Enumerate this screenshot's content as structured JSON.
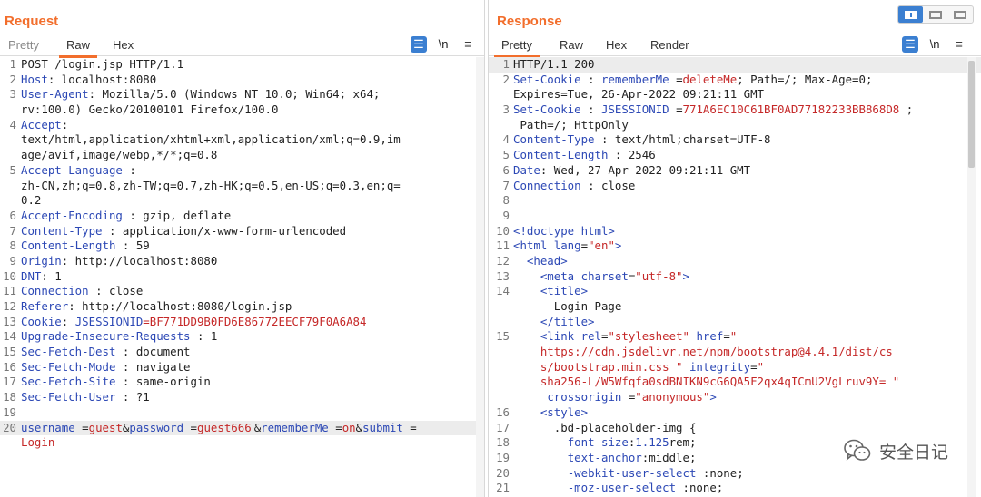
{
  "request": {
    "title": "Request",
    "tabs": [
      "Pretty",
      "Raw",
      "Hex"
    ],
    "active_tab": "Raw",
    "lines": [
      {
        "n": "1",
        "segs": [
          [
            "",
            "POST /login.jsp HTTP/1.1"
          ]
        ]
      },
      {
        "n": "2",
        "segs": [
          [
            "k",
            "Host"
          ],
          [
            "",
            ": localhost:8080"
          ]
        ]
      },
      {
        "n": "3",
        "segs": [
          [
            "k",
            "User-Agent"
          ],
          [
            "",
            ": Mozilla/5.0 (Windows NT 10.0; Win64; x64;"
          ]
        ]
      },
      {
        "n": "",
        "segs": [
          [
            "",
            "rv:100.0) Gecko/20100101 Firefox/100.0"
          ]
        ]
      },
      {
        "n": "4",
        "segs": [
          [
            "k",
            "Accept"
          ],
          [
            "",
            ":"
          ]
        ]
      },
      {
        "n": "",
        "segs": [
          [
            "",
            "text/html,application/xhtml+xml,application/xml;q=0.9,im"
          ]
        ]
      },
      {
        "n": "",
        "segs": [
          [
            "",
            "age/avif,image/webp,*/*;q=0.8"
          ]
        ]
      },
      {
        "n": "5",
        "segs": [
          [
            "k",
            "Accept-Language"
          ],
          [
            "",
            " :"
          ]
        ]
      },
      {
        "n": "",
        "segs": [
          [
            "",
            "zh-CN,zh;q=0.8,zh-TW;q=0.7,zh-HK;q=0.5,en-US;q=0.3,en;q="
          ]
        ]
      },
      {
        "n": "",
        "segs": [
          [
            "",
            "0.2"
          ]
        ]
      },
      {
        "n": "6",
        "segs": [
          [
            "k",
            "Accept-Encoding"
          ],
          [
            "",
            " : gzip, deflate"
          ]
        ]
      },
      {
        "n": "7",
        "segs": [
          [
            "k",
            "Content-Type"
          ],
          [
            "",
            " : application/x-www-form-urlencoded"
          ]
        ]
      },
      {
        "n": "8",
        "segs": [
          [
            "k",
            "Content-Length"
          ],
          [
            "",
            " : 59"
          ]
        ]
      },
      {
        "n": "9",
        "segs": [
          [
            "k",
            "Origin"
          ],
          [
            "",
            ": http://localhost:8080"
          ]
        ]
      },
      {
        "n": "10",
        "segs": [
          [
            "k",
            "DNT"
          ],
          [
            "",
            ": 1"
          ]
        ]
      },
      {
        "n": "11",
        "segs": [
          [
            "k",
            "Connection"
          ],
          [
            "",
            " : close"
          ]
        ]
      },
      {
        "n": "12",
        "segs": [
          [
            "k",
            "Referer"
          ],
          [
            "",
            ": http://localhost:8080/login.jsp"
          ]
        ]
      },
      {
        "n": "13",
        "segs": [
          [
            "k",
            "Cookie"
          ],
          [
            "",
            ": "
          ],
          [
            "k",
            "JSESSIONID"
          ],
          [
            "v",
            "=BF771DD9B0FD6E86772EECF79F0A6A84"
          ]
        ]
      },
      {
        "n": "14",
        "segs": [
          [
            "k",
            "Upgrade-Insecure-Requests"
          ],
          [
            "",
            " : 1"
          ]
        ]
      },
      {
        "n": "15",
        "segs": [
          [
            "k",
            "Sec-Fetch-Dest"
          ],
          [
            "",
            " : document"
          ]
        ]
      },
      {
        "n": "16",
        "segs": [
          [
            "k",
            "Sec-Fetch-Mode"
          ],
          [
            "",
            " : navigate"
          ]
        ]
      },
      {
        "n": "17",
        "segs": [
          [
            "k",
            "Sec-Fetch-Site"
          ],
          [
            "",
            " : same-origin"
          ]
        ]
      },
      {
        "n": "18",
        "segs": [
          [
            "k",
            "Sec-Fetch-User"
          ],
          [
            "",
            " : ?1"
          ]
        ]
      },
      {
        "n": "19",
        "segs": []
      },
      {
        "n": "20",
        "hl": true,
        "segs": [
          [
            "k",
            "username"
          ],
          [
            "",
            " ="
          ],
          [
            "v",
            "guest"
          ],
          [
            "",
            "&"
          ],
          [
            "k",
            "password"
          ],
          [
            "",
            " ="
          ],
          [
            "v",
            "guest666"
          ],
          [
            "caret",
            ""
          ],
          [
            "",
            "&"
          ],
          [
            "k",
            "rememberMe"
          ],
          [
            "",
            " ="
          ],
          [
            "v",
            "on"
          ],
          [
            "",
            "&"
          ],
          [
            "k",
            "submit"
          ],
          [
            "",
            " ="
          ]
        ]
      },
      {
        "n": "",
        "segs": [
          [
            "v",
            "Login"
          ]
        ]
      }
    ]
  },
  "response": {
    "title": "Response",
    "tabs": [
      "Pretty",
      "Raw",
      "Hex",
      "Render"
    ],
    "active_tab": "Pretty",
    "lines": [
      {
        "n": "1",
        "hl": true,
        "segs": [
          [
            "",
            "HTTP/1.1 200"
          ]
        ]
      },
      {
        "n": "2",
        "segs": [
          [
            "k",
            "Set-Cookie"
          ],
          [
            "",
            " : "
          ],
          [
            "k",
            "rememberMe"
          ],
          [
            "",
            " ="
          ],
          [
            "v",
            "deleteMe"
          ],
          [
            "",
            "; Path=/; Max-Age=0;"
          ]
        ]
      },
      {
        "n": "",
        "segs": [
          [
            "",
            "Expires=Tue, 26-Apr-2022 09:21:11 GMT"
          ]
        ]
      },
      {
        "n": "3",
        "segs": [
          [
            "k",
            "Set-Cookie"
          ],
          [
            "",
            " : "
          ],
          [
            "k",
            "JSESSIONID"
          ],
          [
            "",
            " ="
          ],
          [
            "v",
            "771A6EC10C61BF0AD77182233BB868D8"
          ],
          [
            "",
            " ;"
          ]
        ]
      },
      {
        "n": "",
        "segs": [
          [
            "",
            " Path=/; HttpOnly"
          ]
        ]
      },
      {
        "n": "4",
        "segs": [
          [
            "k",
            "Content-Type"
          ],
          [
            "",
            " : text/html;charset=UTF-8"
          ]
        ]
      },
      {
        "n": "5",
        "segs": [
          [
            "k",
            "Content-Length"
          ],
          [
            "",
            " : 2546"
          ]
        ]
      },
      {
        "n": "6",
        "segs": [
          [
            "k",
            "Date"
          ],
          [
            "",
            ": Wed, 27 Apr 2022 09:21:11 GMT"
          ]
        ]
      },
      {
        "n": "7",
        "segs": [
          [
            "k",
            "Connection"
          ],
          [
            "",
            " : close"
          ]
        ]
      },
      {
        "n": "8",
        "segs": []
      },
      {
        "n": "9",
        "segs": []
      },
      {
        "n": "10",
        "segs": [
          [
            "t",
            "<!doctype html>"
          ]
        ]
      },
      {
        "n": "11",
        "segs": [
          [
            "t",
            "<html "
          ],
          [
            "k",
            "lang"
          ],
          [
            "",
            "="
          ],
          [
            "s",
            "\"en\""
          ],
          [
            "t",
            ">"
          ]
        ]
      },
      {
        "n": "12",
        "segs": [
          [
            "",
            "  "
          ],
          [
            "t",
            "<head>"
          ]
        ]
      },
      {
        "n": "13",
        "segs": [
          [
            "",
            "    "
          ],
          [
            "t",
            "<meta "
          ],
          [
            "k",
            "charset"
          ],
          [
            "",
            "="
          ],
          [
            "s",
            "\"utf-8\""
          ],
          [
            "t",
            ">"
          ]
        ]
      },
      {
        "n": "14",
        "segs": [
          [
            "",
            "    "
          ],
          [
            "t",
            "<title>"
          ]
        ]
      },
      {
        "n": "",
        "segs": [
          [
            "",
            "      Login Page"
          ]
        ]
      },
      {
        "n": "",
        "segs": [
          [
            "",
            "    "
          ],
          [
            "t",
            "</title>"
          ]
        ]
      },
      {
        "n": "15",
        "segs": [
          [
            "",
            "    "
          ],
          [
            "t",
            "<link "
          ],
          [
            "k",
            "rel"
          ],
          [
            "",
            "="
          ],
          [
            "s",
            "\"stylesheet\""
          ],
          [
            "",
            " "
          ],
          [
            "k",
            "href"
          ],
          [
            "",
            "="
          ],
          [
            "s",
            "\""
          ]
        ]
      },
      {
        "n": "",
        "segs": [
          [
            "s",
            "    https://cdn.jsdelivr.net/npm/bootstrap@4.4.1/dist/cs"
          ]
        ]
      },
      {
        "n": "",
        "segs": [
          [
            "s",
            "    s/bootstrap.min.css \""
          ],
          [
            "",
            " "
          ],
          [
            "k",
            "integrity"
          ],
          [
            "",
            "="
          ],
          [
            "s",
            "\""
          ]
        ]
      },
      {
        "n": "",
        "segs": [
          [
            "s",
            "    sha256-L/W5Wfqfa0sdBNIKN9cG6QA5F2qx4qICmU2VgLruv9Y= \""
          ]
        ]
      },
      {
        "n": "",
        "segs": [
          [
            "",
            "     "
          ],
          [
            "k",
            "crossorigin"
          ],
          [
            "",
            " ="
          ],
          [
            "s",
            "\"anonymous\""
          ],
          [
            "t",
            ">"
          ]
        ]
      },
      {
        "n": "16",
        "segs": [
          [
            "",
            "    "
          ],
          [
            "t",
            "<style>"
          ]
        ]
      },
      {
        "n": "17",
        "segs": [
          [
            "",
            "      .bd-placeholder-img {"
          ]
        ]
      },
      {
        "n": "18",
        "segs": [
          [
            "",
            "        "
          ],
          [
            "k",
            "font-size"
          ],
          [
            "",
            ":"
          ],
          [
            "k",
            "1.125"
          ],
          [
            "",
            "rem;"
          ]
        ]
      },
      {
        "n": "19",
        "segs": [
          [
            "",
            "        "
          ],
          [
            "k",
            "text-anchor"
          ],
          [
            "",
            ":middle;"
          ]
        ]
      },
      {
        "n": "20",
        "segs": [
          [
            "",
            "        "
          ],
          [
            "k",
            "-webkit-user-select"
          ],
          [
            "",
            " :none;"
          ]
        ]
      },
      {
        "n": "21",
        "segs": [
          [
            "",
            "        "
          ],
          [
            "k",
            "-moz-user-select"
          ],
          [
            "",
            " :none;"
          ]
        ]
      }
    ]
  },
  "toolbar": {
    "wrap_icon": "wrap-lines-icon",
    "newline_label": "\\n",
    "menu_icon": "hamburger-menu-icon"
  },
  "watermark": {
    "text": "安全日记",
    "icon": "wechat-icon"
  },
  "colors": {
    "accent": "#f26e2c",
    "toggle_blue": "#3b7fd1",
    "key_blue": "#2c48b5",
    "value_red": "#c52828"
  }
}
